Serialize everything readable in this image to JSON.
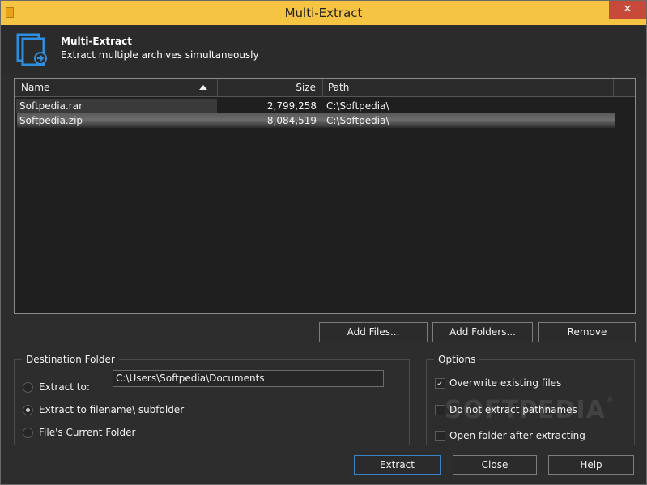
{
  "window": {
    "title": "Multi-Extract",
    "close_glyph": "✕"
  },
  "header": {
    "title": "Multi-Extract",
    "subtitle": "Extract multiple archives simultaneously",
    "icon": "archive-extract-icon"
  },
  "file_list": {
    "columns": [
      "Name",
      "Size",
      "Path"
    ],
    "sorted_by": "Name",
    "rows": [
      {
        "name": "Softpedia.rar",
        "size": "2,799,258",
        "path": "C:\\Softpedia\\"
      },
      {
        "name": "Softpedia.zip",
        "size": "8,084,519",
        "path": "C:\\Softpedia\\"
      }
    ]
  },
  "list_buttons": {
    "add_files": "Add Files...",
    "add_folders": "Add Folders...",
    "remove": "Remove"
  },
  "destination": {
    "legend": "Destination Folder",
    "extract_to_label": "Extract to:",
    "path_value": "C:\\Users\\Softpedia\\Documents",
    "subfolder_label": "Extract to filename\\ subfolder",
    "current_folder_label": "File's Current Folder",
    "selected": "subfolder"
  },
  "options": {
    "legend": "Options",
    "overwrite_label": "Overwrite existing files",
    "overwrite_checked": true,
    "no_pathnames_label": "Do not extract pathnames",
    "no_pathnames_checked": false,
    "open_folder_label": "Open folder after extracting",
    "open_folder_checked": false,
    "check_glyph": "✓"
  },
  "footer_buttons": {
    "extract": "Extract",
    "close": "Close",
    "help": "Help"
  },
  "watermark": {
    "text": "SOFTPEDIA",
    "mark": "®"
  },
  "colors": {
    "titlebar": "#f6c443",
    "background": "#2d2d2d",
    "accent_border": "#3c83c6",
    "close_button": "#c7493a"
  }
}
